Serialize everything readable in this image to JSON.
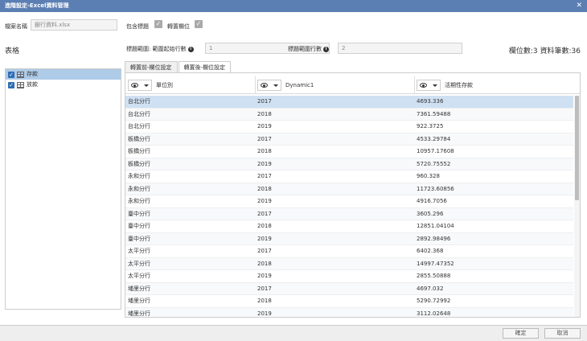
{
  "dialog": {
    "title": "進階設定-Excel資料管理",
    "close_icon": "✕"
  },
  "file": {
    "label": "檔案名稱",
    "value": "銀行資料.xlsx"
  },
  "options": {
    "include_header_label": "包含標題",
    "transpose_label": "轉置欄位"
  },
  "range": {
    "start_label": "標題範圍: 範圍起始行數",
    "start_value": "1",
    "end_label": "標題範圍行數",
    "end_value": "2"
  },
  "summary": "欄位數:3 資料筆數:36",
  "sheets": {
    "title": "表格",
    "items": [
      {
        "label": "存款",
        "checked": true,
        "selected": true
      },
      {
        "label": "放款",
        "checked": true,
        "selected": false
      }
    ]
  },
  "tabs": [
    {
      "label": "轉置前-欄位設定",
      "active": false
    },
    {
      "label": "轉置後-欄位設定",
      "active": true
    }
  ],
  "grid": {
    "columns": [
      "單位別",
      "Dynamic1",
      "活期性存款"
    ],
    "rows": [
      [
        "台北分行",
        "2017",
        "4693.336"
      ],
      [
        "台北分行",
        "2018",
        "7361.59488"
      ],
      [
        "台北分行",
        "2019",
        "922.3725"
      ],
      [
        "板橋分行",
        "2017",
        "4533.29784"
      ],
      [
        "板橋分行",
        "2018",
        "10957.17608"
      ],
      [
        "板橋分行",
        "2019",
        "5720.75552"
      ],
      [
        "永和分行",
        "2017",
        "960.328"
      ],
      [
        "永和分行",
        "2018",
        "11723.60856"
      ],
      [
        "永和分行",
        "2019",
        "4916.7056"
      ],
      [
        "臺中分行",
        "2017",
        "3605.296"
      ],
      [
        "臺中分行",
        "2018",
        "12851.04104"
      ],
      [
        "臺中分行",
        "2019",
        "2892.98496"
      ],
      [
        "太平分行",
        "2017",
        "6402.368"
      ],
      [
        "太平分行",
        "2018",
        "14997.47352"
      ],
      [
        "太平分行",
        "2019",
        "2855.50888"
      ],
      [
        "埔里分行",
        "2017",
        "4697.032"
      ],
      [
        "埔里分行",
        "2018",
        "5290.72992"
      ],
      [
        "埔里分行",
        "2019",
        "3112.02648"
      ]
    ]
  },
  "buttons": {
    "ok": "確定",
    "cancel": "取消"
  }
}
